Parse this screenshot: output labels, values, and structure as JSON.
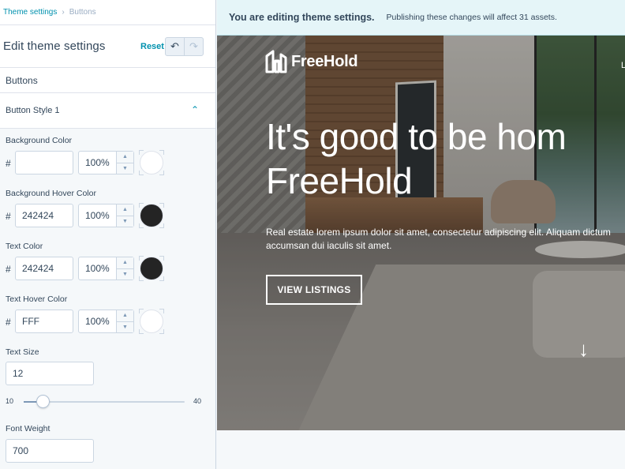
{
  "breadcrumb": {
    "parent": "Theme settings",
    "current": "Buttons"
  },
  "panel": {
    "title": "Edit theme settings",
    "reset_label": "Reset"
  },
  "section": {
    "heading": "Buttons",
    "style_label": "Button Style 1"
  },
  "fields": [
    {
      "label": "Background Color",
      "hex": "",
      "opacity": "100%",
      "swatch": "#ffffff"
    },
    {
      "label": "Background Hover Color",
      "hex": "242424",
      "opacity": "100%",
      "swatch": "#242424"
    },
    {
      "label": "Text Color",
      "hex": "242424",
      "opacity": "100%",
      "swatch": "#242424"
    },
    {
      "label": "Text Hover Color",
      "hex": "FFF",
      "opacity": "100%",
      "swatch": "#ffffff"
    }
  ],
  "text_size": {
    "label": "Text Size",
    "value": "12",
    "min": "10",
    "max": "40",
    "slider_value": 12
  },
  "font_weight": {
    "label": "Font Weight",
    "value": "700"
  },
  "banner": {
    "strong": "You are editing theme settings.",
    "text": "Publishing these changes will affect 31 assets."
  },
  "hero": {
    "logo_text": "FreeHold",
    "nav_peek": "L",
    "headline_line1": "It's good to be hom",
    "headline_line2": "FreeHold",
    "body_line1": "Real estate lorem ipsum dolor sit amet, consectetur adipiscing elit. Aliquam dictum",
    "body_line2": "accumsan dui iaculis sit amet.",
    "button_label": "VIEW LISTINGS"
  },
  "colors": {
    "accent": "#0091ae",
    "text": "#33475b",
    "banner_bg": "#e5f5f8"
  },
  "icons": {
    "undo": "undo-icon",
    "redo": "redo-icon",
    "collapse": "chevron-up-icon",
    "scroll": "arrow-down-icon"
  }
}
